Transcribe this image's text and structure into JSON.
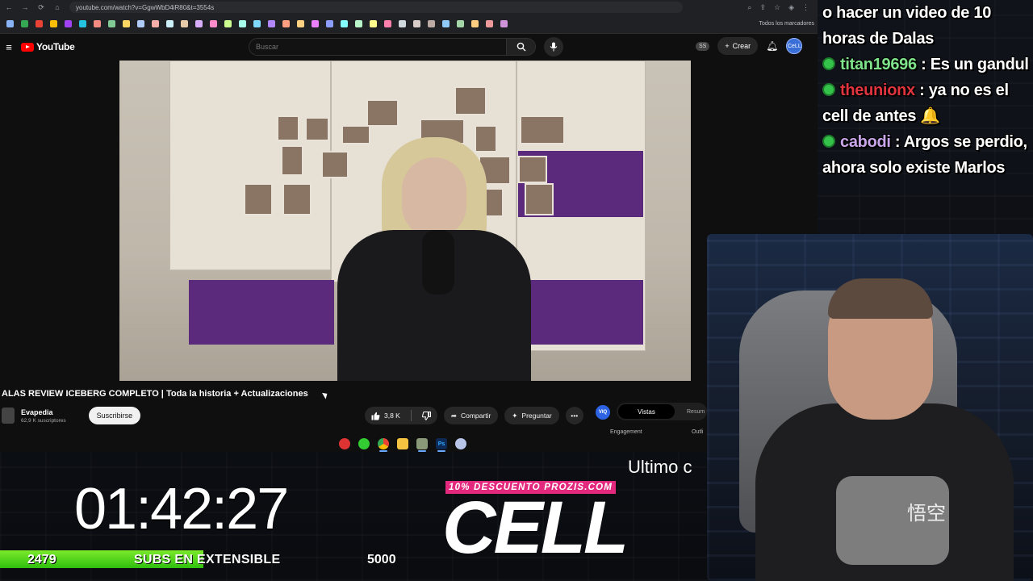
{
  "browser": {
    "url": "youtube.com/watch?v=GgwWbD4iR80&t=3554s",
    "bookmarks_all": "Todos los marcadores",
    "bookmark_colors": [
      "#8ab4f8",
      "#34a853",
      "#ea4335",
      "#fbbc04",
      "#a142f4",
      "#24c1e0",
      "#f28b82",
      "#81c995",
      "#fdd663",
      "#aecbfa",
      "#f6aea9",
      "#cbf0f8",
      "#e6c9a8",
      "#d7aefb",
      "#ff8bcb",
      "#ccff90",
      "#a7ffeb",
      "#80d8ff",
      "#b388ff",
      "#ff9e80",
      "#ffd180",
      "#ea80fc",
      "#8c9eff",
      "#84ffff",
      "#b9f6ca",
      "#ffff8d",
      "#ff80ab",
      "#cfd8dc",
      "#d7ccc8",
      "#bcaaa4",
      "#90caf9",
      "#a5d6a7",
      "#ffcc80",
      "#ef9a9a",
      "#ce93d8"
    ]
  },
  "youtube": {
    "logo_text": "YouTube",
    "search_placeholder": "Buscar",
    "ss_badge": "SS",
    "create_label": "Crear",
    "avatar_text": "CeLL",
    "video_title": "ALAS REVIEW ICEBERG COMPLETO | Toda la historia + Actualizaciones",
    "channel_name": "Evapedia",
    "channel_subs": "62,9 K suscriptores",
    "subscribe_label": "Suscribirse",
    "likes": "3,8 K",
    "share_label": "Compartir",
    "ask_label": "Preguntar",
    "panel": {
      "logo": "VIQ",
      "tab_active": "Vistas",
      "tab_other": "Resum",
      "engagement": "Engagement",
      "outliers": "Outli"
    }
  },
  "chat": [
    {
      "user": "",
      "message": "o hacer un video de 10 horas de Dalas",
      "color": ""
    },
    {
      "user": "titan19696",
      "message": " : Es un gandul",
      "color": "#7fe38b"
    },
    {
      "user": "theunionx",
      "message": " : ya no es el cell de antes 🔔",
      "color": "#e0343f"
    },
    {
      "user": "cabodi",
      "message": " : Argos se perdio, ahora solo existe Marlos",
      "color": "#c9a6ea"
    }
  ],
  "overlay": {
    "timer": "01:42:27",
    "subs_count": "2479",
    "subs_label": "SUBS EN EXTENSIBLE",
    "subs_goal": "5000",
    "subs_progress": 0.4958,
    "ultimo": "Ultimo c",
    "promo": "10% DESCUENTO PROZIS.COM",
    "cell": "CELL"
  },
  "webcam": {
    "shirt_text": "悟空"
  }
}
